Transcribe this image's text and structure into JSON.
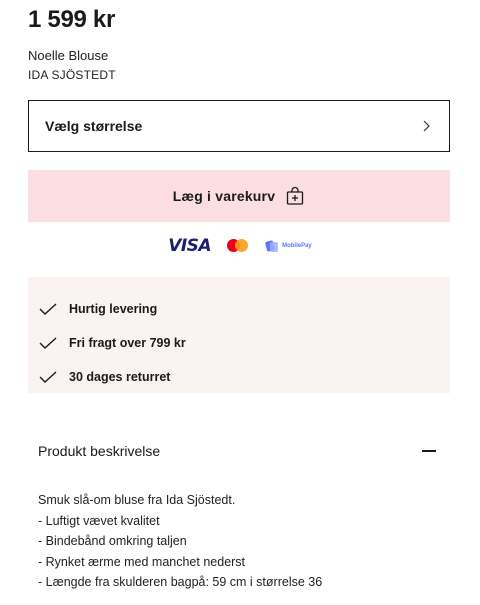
{
  "product": {
    "price": "1 599 kr",
    "name": "Noelle Blouse",
    "brand": "IDA SJÖSTEDT"
  },
  "size_select": {
    "label": "Vælg størrelse",
    "icon": "chevron-right-icon"
  },
  "cart_button": {
    "label": "Læg i varekurv",
    "icon": "bag-plus-icon"
  },
  "payment_methods": [
    {
      "name": "VISA",
      "icon": "visa-logo"
    },
    {
      "name": "Mastercard",
      "icon": "mastercard-logo"
    },
    {
      "name": "MobilePay",
      "icon": "mobilepay-logo"
    }
  ],
  "benefits": [
    {
      "text": "Hurtig levering",
      "icon": "check-icon"
    },
    {
      "text": "Fri fragt over 799 kr",
      "icon": "check-icon"
    },
    {
      "text": "30 dages returret",
      "icon": "check-icon"
    }
  ],
  "description": {
    "title": "Produkt beskrivelse",
    "toggle_icon": "minus-icon",
    "lines": [
      "Smuk slå-om bluse fra Ida Sjöstedt.",
      "- Luftigt vævet kvalitet",
      "- Bindebånd omkring taljen",
      "- Rynket ærme med manchet nederst",
      "- Længde fra skulderen bagpå: 59 cm i størrelse 36"
    ]
  },
  "colors": {
    "accent_pink": "#fcdde2",
    "benefits_bg": "#fbf2f2",
    "visa_blue": "#1a1f71"
  }
}
